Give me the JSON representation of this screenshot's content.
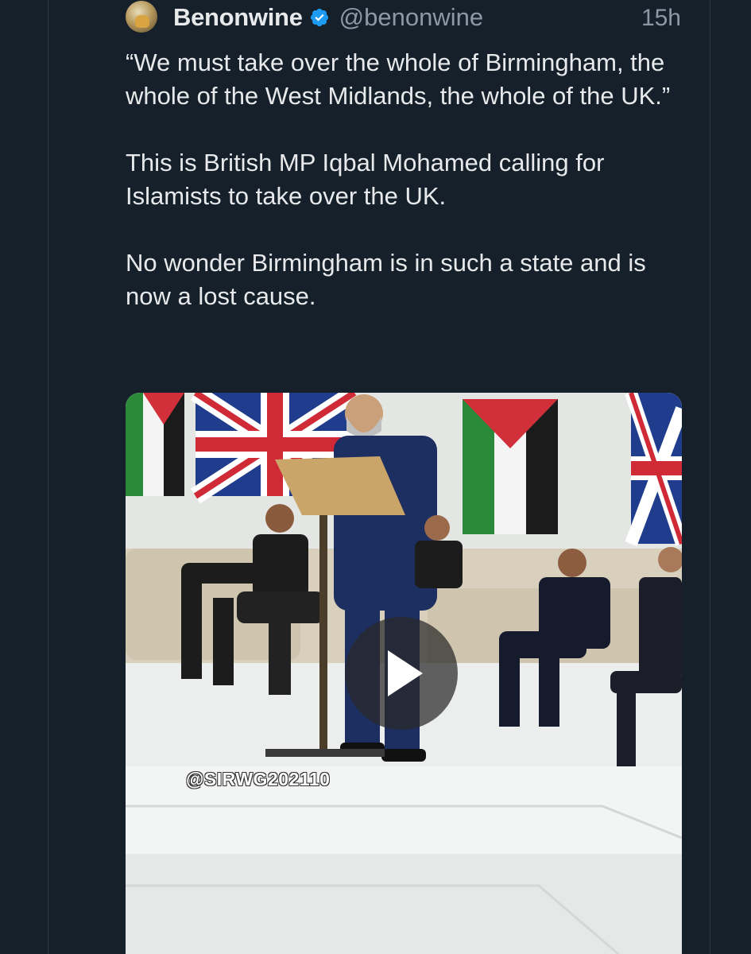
{
  "tweet": {
    "display_name": "Benonwine",
    "handle": "@benonwine",
    "time": "15h",
    "verified": true,
    "paragraphs": [
      "“We must take over the whole of Birmingham, the whole of the West Midlands, the whole of the UK.”",
      "This is British MP Iqbal Mohamed calling for Islamists to take over the UK.",
      "No wonder Birmingham is in such a state and is now a lost cause."
    ]
  },
  "media": {
    "type": "video",
    "watermark": "@SIRWG202110",
    "play_icon": "play-icon"
  },
  "colors": {
    "background": "#15202b",
    "primary_text": "#e7e9ea",
    "secondary_text": "#8b98a5",
    "verified_badge": "#1d9bf0"
  }
}
